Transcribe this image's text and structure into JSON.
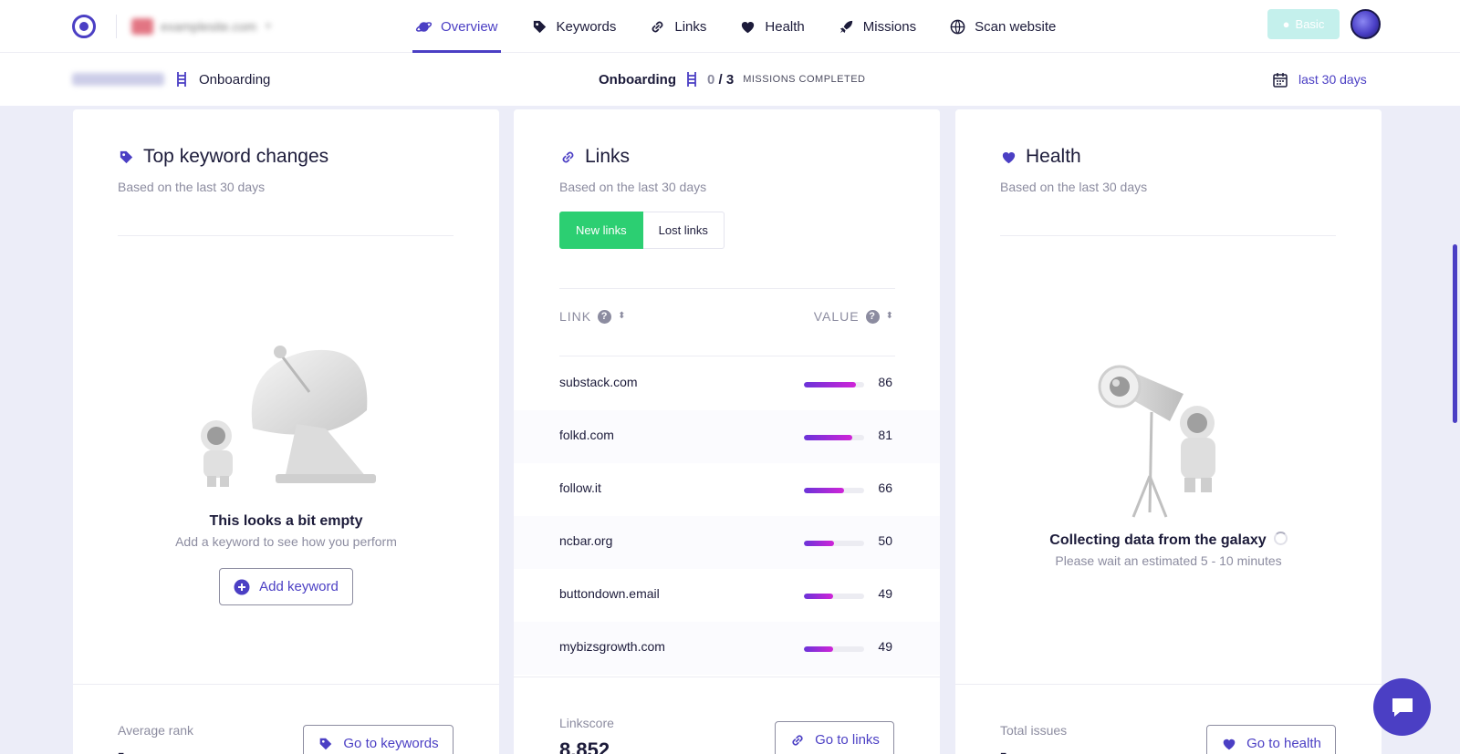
{
  "header": {
    "site": "examplesite.com",
    "nav": [
      {
        "label": "Overview",
        "icon": "planet-icon",
        "active": true
      },
      {
        "label": "Keywords",
        "icon": "tag-icon"
      },
      {
        "label": "Links",
        "icon": "link-icon"
      },
      {
        "label": "Health",
        "icon": "heart-icon"
      },
      {
        "label": "Missions",
        "icon": "rocket-icon"
      },
      {
        "label": "Scan website",
        "icon": "globe-icon"
      }
    ],
    "plan_label": "Basic"
  },
  "subbar": {
    "left_chip": "20,000 visits",
    "left_label": "Onboarding",
    "center_label": "Onboarding",
    "missions_done": "0",
    "missions_sep": "/",
    "missions_total": "3",
    "missions_label": "MISSIONS COMPLETED",
    "date_range": "last 30 days"
  },
  "keywords_card": {
    "title": "Top keyword changes",
    "subtitle": "Based on the last 30 days",
    "empty_title": "This looks a bit empty",
    "empty_sub": "Add a keyword to see how you perform",
    "add_button": "Add keyword",
    "footer_label": "Average rank",
    "footer_value": "-",
    "footer_button": "Go to keywords"
  },
  "links_card": {
    "title": "Links",
    "subtitle": "Based on the last 30 days",
    "tabs": [
      "New links",
      "Lost links"
    ],
    "col_link": "LINK",
    "col_value": "VALUE",
    "rows": [
      {
        "link": "substack.com",
        "value": 86
      },
      {
        "link": "folkd.com",
        "value": 81
      },
      {
        "link": "follow.it",
        "value": 66
      },
      {
        "link": "ncbar.org",
        "value": 50
      },
      {
        "link": "buttondown.email",
        "value": 49
      },
      {
        "link": "mybizsgrowth.com",
        "value": 49
      }
    ],
    "footer_label": "Linkscore",
    "footer_value": "8,852",
    "footer_button": "Go to links"
  },
  "health_card": {
    "title": "Health",
    "subtitle": "Based on the last 30 days",
    "status_title": "Collecting data from the galaxy",
    "status_sub": "Please wait an estimated 5 - 10 minutes",
    "footer_label": "Total issues",
    "footer_value": "-",
    "footer_button": "Go to health"
  },
  "colors": {
    "accent": "#4b3fc4",
    "green": "#2ccf72",
    "muted": "#8c8ca0"
  }
}
